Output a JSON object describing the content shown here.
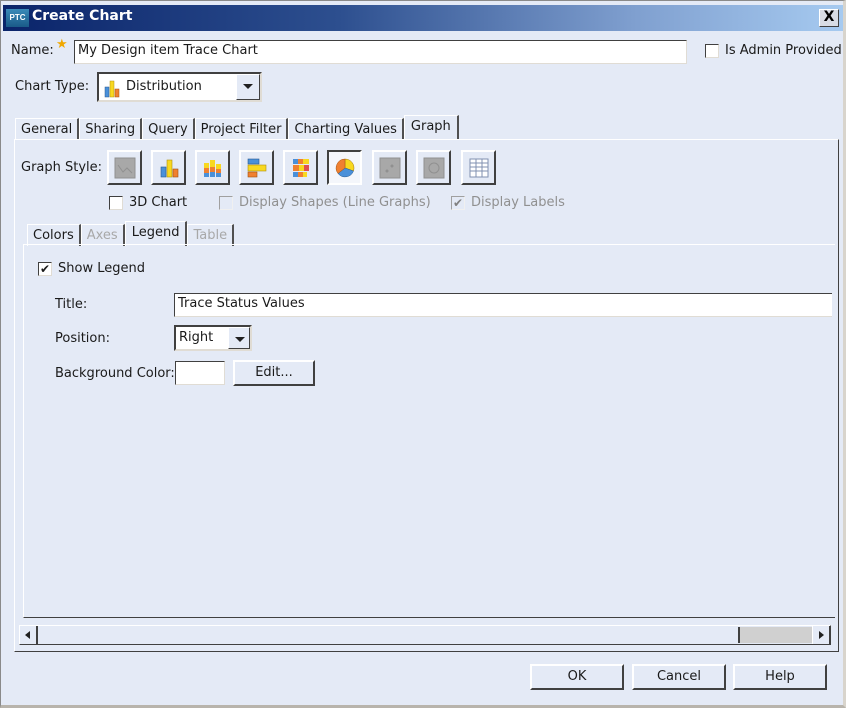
{
  "window": {
    "logo": "PTC",
    "title": "Create Chart",
    "close_label": "X"
  },
  "header": {
    "name_label": "Name:",
    "name_value": "My Design item Trace Chart",
    "is_admin_label": "Is Admin Provided",
    "is_admin_checked": false,
    "chart_type_label": "Chart Type:",
    "chart_type_value": "Distribution"
  },
  "tabs": [
    {
      "label": "General",
      "active": false
    },
    {
      "label": "Sharing",
      "active": false
    },
    {
      "label": "Query",
      "active": false
    },
    {
      "label": "Project Filter",
      "active": false
    },
    {
      "label": "Charting Values",
      "active": false
    },
    {
      "label": "Graph",
      "active": true
    }
  ],
  "graph": {
    "style_label": "Graph Style:",
    "styles": [
      {
        "name": "line-chart",
        "enabled": false,
        "selected": false
      },
      {
        "name": "bar-chart",
        "enabled": true,
        "selected": false
      },
      {
        "name": "stacked-bar-chart",
        "enabled": true,
        "selected": false
      },
      {
        "name": "horizontal-bar-chart",
        "enabled": true,
        "selected": false
      },
      {
        "name": "stacked-horizontal-bar-chart",
        "enabled": true,
        "selected": false
      },
      {
        "name": "pie-chart",
        "enabled": true,
        "selected": true
      },
      {
        "name": "scatter-chart",
        "enabled": false,
        "selected": false
      },
      {
        "name": "radar-chart",
        "enabled": false,
        "selected": false
      },
      {
        "name": "table",
        "enabled": true,
        "selected": false
      }
    ],
    "three_d_label": "3D Chart",
    "three_d_checked": false,
    "display_shapes_label": "Display Shapes (Line Graphs)",
    "display_shapes_checked": false,
    "display_labels_label": "Display Labels",
    "display_labels_checked": true
  },
  "subtabs": [
    {
      "label": "Colors",
      "active": false,
      "enabled": true
    },
    {
      "label": "Axes",
      "active": false,
      "enabled": false
    },
    {
      "label": "Legend",
      "active": true,
      "enabled": true
    },
    {
      "label": "Table",
      "active": false,
      "enabled": false
    }
  ],
  "legend": {
    "show_label": "Show Legend",
    "show_checked": true,
    "title_label": "Title:",
    "title_value": "Trace Status Values",
    "position_label": "Position:",
    "position_value": "Right",
    "bg_color_label": "Background Color:",
    "bg_color_value": "#ffffff",
    "edit_label": "Edit..."
  },
  "footer": {
    "ok_label": "OK",
    "cancel_label": "Cancel",
    "help_label": "Help"
  },
  "check_glyph": "✔"
}
